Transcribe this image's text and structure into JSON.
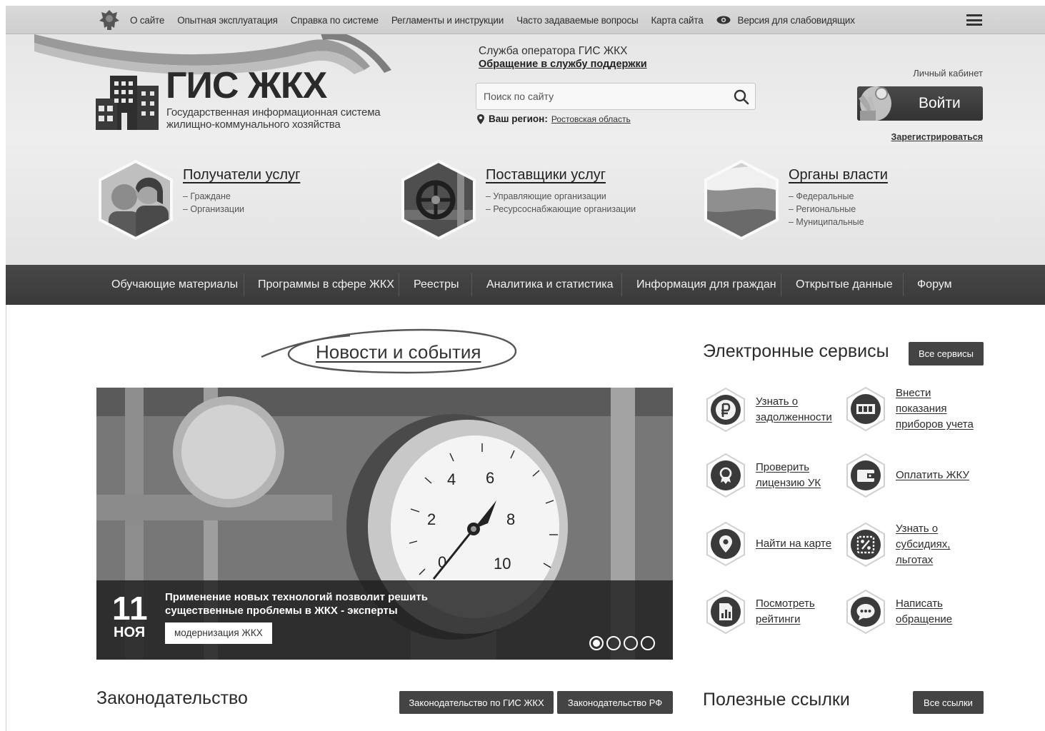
{
  "topbar": {
    "links": [
      "О сайте",
      "Опытная эксплуатация",
      "Справка по системе",
      "Регламенты и инструкции",
      "Часто задаваемые вопросы",
      "Карта сайта"
    ],
    "accessibility": "Версия для слабовидящих"
  },
  "header": {
    "logo_title": "ГИС ЖКХ",
    "logo_sub_line1": "Государственная информационная система",
    "logo_sub_line2": "жилищно-коммунального хозяйства",
    "support_title": "Служба оператора ГИС ЖКХ",
    "support_link": "Обращение в службу поддержки",
    "search_placeholder": "Поиск по сайту",
    "region_label": "Ваш регион:",
    "region_value": "Ростовская область",
    "cabinet_label": "Личный кабинет",
    "login": "Войти",
    "register": "Зарегистрироваться"
  },
  "categories": [
    {
      "title": "Получатели услуг",
      "items": [
        "– Граждане",
        "– Организации"
      ]
    },
    {
      "title": "Поставщики услуг",
      "items": [
        "– Управляющие организации",
        "– Ресурсоснабжающие организации"
      ]
    },
    {
      "title": "Органы власти",
      "items": [
        "– Федеральные",
        "– Региональные",
        "– Муниципальные"
      ]
    }
  ],
  "mainmenu": [
    "Обучающие материалы",
    "Программы в сфере ЖКХ",
    "Реестры",
    "Аналитика и статистика",
    "Информация для граждан",
    "Открытые данные",
    "Форум"
  ],
  "news": {
    "heading": "Новости и события",
    "day": "11",
    "month": "НОЯ",
    "text": "Применение новых технологий позволит решить существенные проблемы в ЖКХ - эксперты",
    "tag": "модернизация ЖКХ",
    "gauge_numbers": [
      "0",
      "2",
      "4",
      "6",
      "8",
      "10"
    ],
    "slides": 4,
    "active_slide": 1
  },
  "services": {
    "heading": "Электронные сервисы",
    "all": "Все сервисы",
    "items": [
      {
        "label1": "Узнать о",
        "label2": "задолженности",
        "label3": "",
        "icon": "ruble-icon"
      },
      {
        "label1": "Внести",
        "label2": "показания",
        "label3": "приборов учета",
        "icon": "meter-icon"
      },
      {
        "label1": "Проверить",
        "label2": "лицензию УК",
        "label3": "",
        "icon": "license-icon"
      },
      {
        "label1": "Оплатить ЖКУ",
        "label2": "",
        "label3": "",
        "icon": "wallet-icon"
      },
      {
        "label1": "Найти на карте",
        "label2": "",
        "label3": "",
        "icon": "map-pin-icon"
      },
      {
        "label1": "Узнать о",
        "label2": "субсидиях,",
        "label3": "льготах",
        "icon": "percent-icon"
      },
      {
        "label1": "Посмотреть",
        "label2": "рейтинги",
        "label3": "",
        "icon": "rating-icon"
      },
      {
        "label1": "Написать",
        "label2": "обращение",
        "label3": "",
        "icon": "message-icon"
      }
    ]
  },
  "law": {
    "heading": "Законодательство",
    "btn1": "Законодательство по ГИС ЖКХ",
    "btn2": "Законодательство РФ"
  },
  "links": {
    "heading": "Полезные ссылки",
    "all": "Все ссылки"
  }
}
